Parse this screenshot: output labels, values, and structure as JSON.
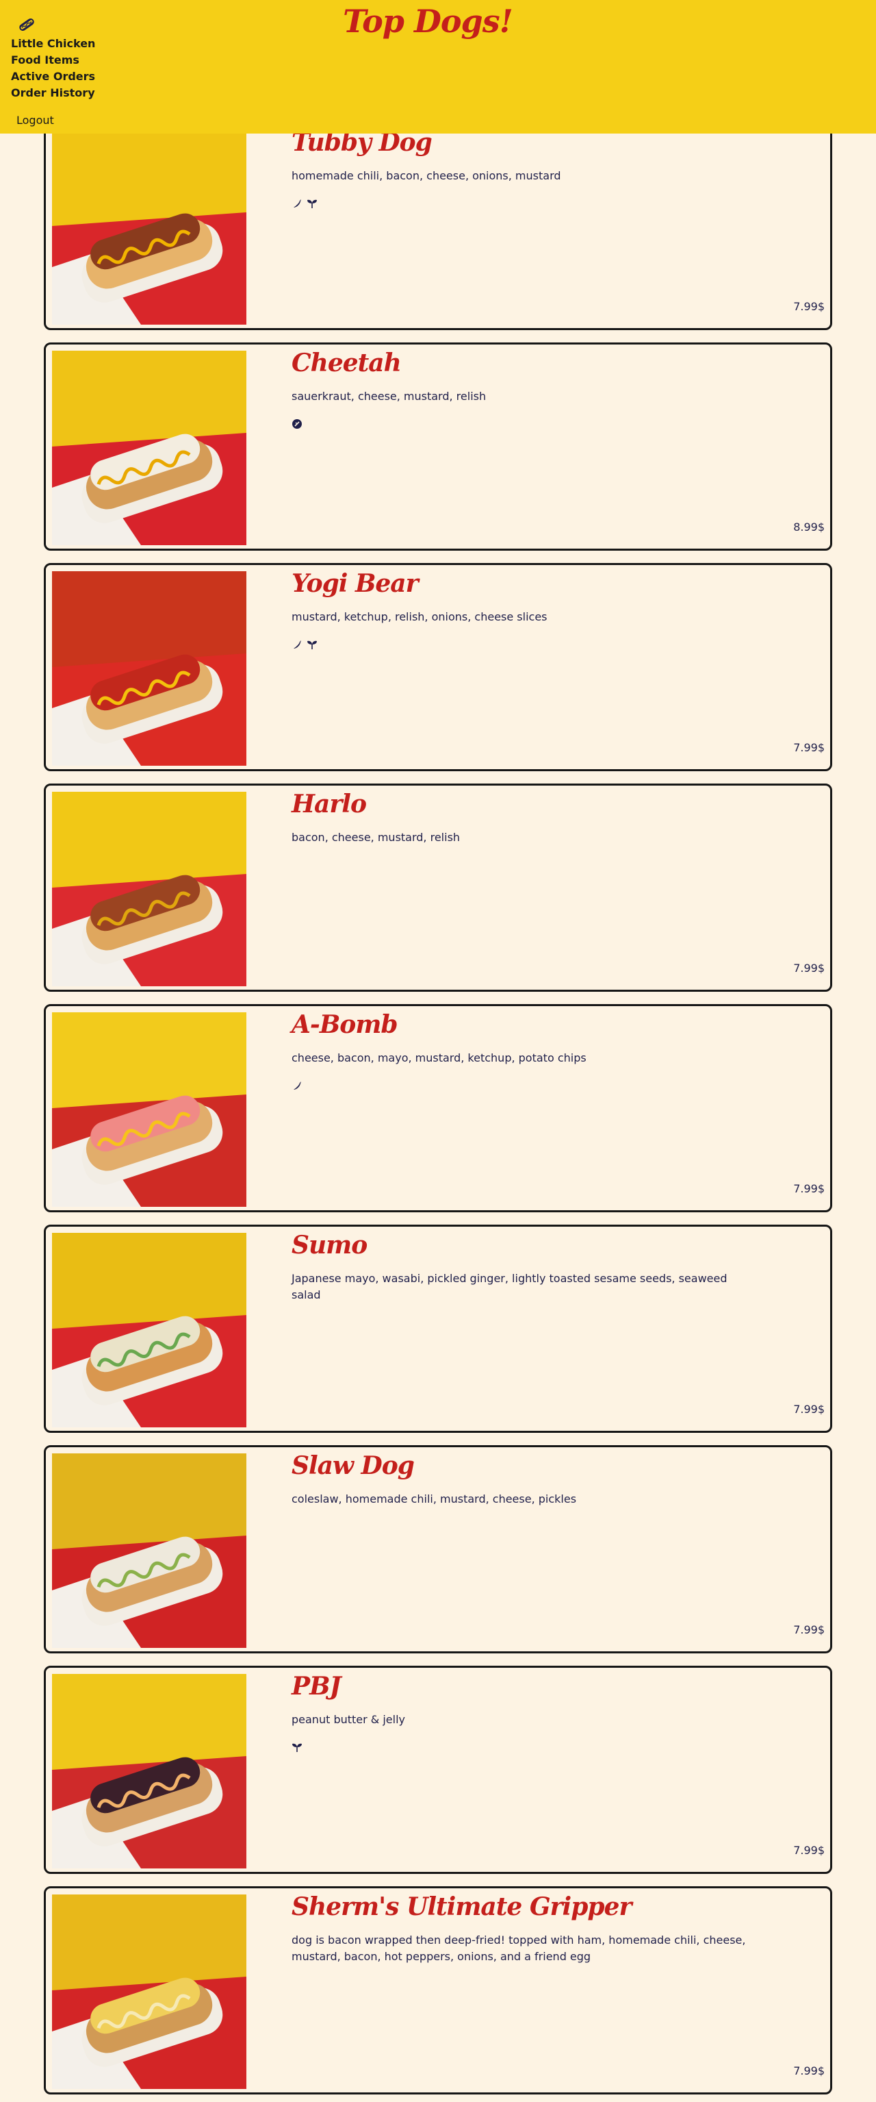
{
  "header": {
    "title": "Top Dogs!",
    "brand_icon": "hotdog-icon",
    "nav": [
      {
        "label": "Little Chicken"
      },
      {
        "label": "Food Items"
      },
      {
        "label": "Active Orders"
      },
      {
        "label": "Order History"
      }
    ],
    "logout_label": "Logout"
  },
  "colors": {
    "header_bg": "#f5cf17",
    "page_bg": "#fdf3e3",
    "title_red": "#c41f1b",
    "text_navy": "#1f1f4a",
    "card_border": "#161616"
  },
  "menu": {
    "items": [
      {
        "name": "Tubby Dog",
        "description": "homemade chili, bacon, cheese, onions, mustard",
        "tags": [
          "spicy-icon",
          "vegetarian-sprout-icon"
        ],
        "price": "7.99$",
        "photo": "tubby-dog-photo"
      },
      {
        "name": "Cheetah",
        "description": "sauerkraut, cheese, mustard, relish",
        "tags": [
          "gluten-free-icon"
        ],
        "price": "8.99$",
        "photo": "cheetah-photo"
      },
      {
        "name": "Yogi Bear",
        "description": "mustard, ketchup, relish, onions, cheese slices",
        "tags": [
          "spicy-icon",
          "vegetarian-sprout-icon"
        ],
        "price": "7.99$",
        "photo": "yogi-bear-photo"
      },
      {
        "name": "Harlo",
        "description": "bacon, cheese, mustard, relish",
        "tags": [],
        "price": "7.99$",
        "photo": "harlo-photo"
      },
      {
        "name": "A-Bomb",
        "description": "cheese, bacon, mayo, mustard, ketchup, potato chips",
        "tags": [
          "spicy-icon"
        ],
        "price": "7.99$",
        "photo": "a-bomb-photo"
      },
      {
        "name": "Sumo",
        "description": "Japanese mayo, wasabi, pickled ginger, lightly toasted sesame seeds, seaweed salad",
        "tags": [],
        "price": "7.99$",
        "photo": "sumo-photo"
      },
      {
        "name": "Slaw Dog",
        "description": "coleslaw, homemade chili, mustard, cheese, pickles",
        "tags": [],
        "price": "7.99$",
        "photo": "slaw-dog-photo"
      },
      {
        "name": "PBJ",
        "description": "peanut butter & jelly",
        "tags": [
          "vegetarian-sprout-icon"
        ],
        "price": "7.99$",
        "photo": "pbj-photo"
      },
      {
        "name": "Sherm's Ultimate Gripper",
        "description": "dog is bacon wrapped then deep-fried! topped with ham, homemade chili, cheese, mustard, bacon, hot peppers, onions, and a friend egg",
        "tags": [],
        "price": "7.99$",
        "photo": "sherms-ultimate-gripper-photo"
      }
    ]
  }
}
